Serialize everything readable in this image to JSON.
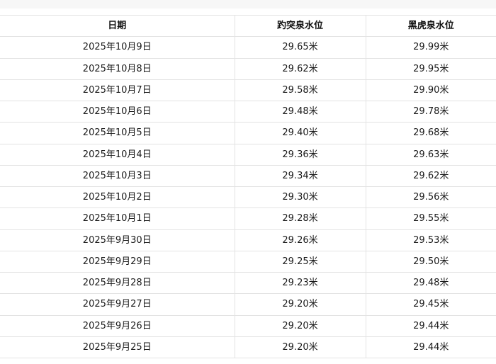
{
  "table": {
    "headers": [
      "日期",
      "趵突泉水位",
      "黑虎泉水位"
    ],
    "rows": [
      [
        "2025年10月9日",
        "29.65米",
        "29.99米"
      ],
      [
        "2025年10月8日",
        "29.62米",
        "29.95米"
      ],
      [
        "2025年10月7日",
        "29.58米",
        "29.90米"
      ],
      [
        "2025年10月6日",
        "29.48米",
        "29.78米"
      ],
      [
        "2025年10月5日",
        "29.40米",
        "29.68米"
      ],
      [
        "2025年10月4日",
        "29.36米",
        "29.63米"
      ],
      [
        "2025年10月3日",
        "29.34米",
        "29.62米"
      ],
      [
        "2025年10月2日",
        "29.30米",
        "29.56米"
      ],
      [
        "2025年10月1日",
        "29.28米",
        "29.55米"
      ],
      [
        "2025年9月30日",
        "29.26米",
        "29.53米"
      ],
      [
        "2025年9月29日",
        "29.25米",
        "29.50米"
      ],
      [
        "2025年9月28日",
        "29.23米",
        "29.48米"
      ],
      [
        "2025年9月27日",
        "29.20米",
        "29.45米"
      ],
      [
        "2025年9月26日",
        "29.20米",
        "29.44米"
      ],
      [
        "2025年9月25日",
        "29.20米",
        "29.44米"
      ]
    ]
  }
}
